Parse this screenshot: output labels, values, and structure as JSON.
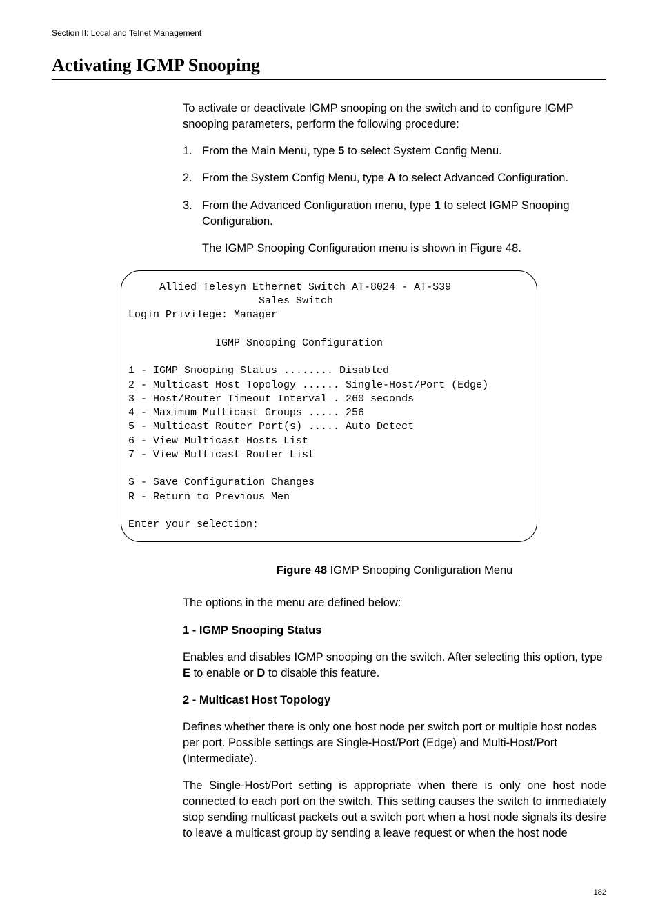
{
  "header": {
    "section": "Section II: Local and Telnet Management"
  },
  "title": "Activating IGMP Snooping",
  "intro": "To activate or deactivate IGMP snooping on the switch and to configure IGMP snooping parameters, perform the following procedure:",
  "steps": [
    {
      "num": "1.",
      "before": "From the Main Menu, type ",
      "key": "5",
      "after": " to select System Config Menu."
    },
    {
      "num": "2.",
      "before": "From the System Config Menu, type ",
      "key": "A",
      "after": " to select Advanced Configuration."
    },
    {
      "num": "3.",
      "before": "From the Advanced Configuration menu, type ",
      "key": "1",
      "after": " to select IGMP Snooping Configuration."
    }
  ],
  "after_steps": "The IGMP Snooping Configuration menu is shown in Figure 48.",
  "terminal": {
    "line_title": "     Allied Telesyn Ethernet Switch AT-8024 - AT-S39",
    "line_sub": "                     Sales Switch",
    "line_login": "Login Privilege: Manager",
    "line_menu": "              IGMP Snooping Configuration",
    "opt1": "1 - IGMP Snooping Status ........ Disabled",
    "opt2": "2 - Multicast Host Topology ...... Single-Host/Port (Edge)",
    "opt3": "3 - Host/Router Timeout Interval . 260 seconds",
    "opt4": "4 - Maximum Multicast Groups ..... 256",
    "opt5": "5 - Multicast Router Port(s) ..... Auto Detect",
    "opt6": "6 - View Multicast Hosts List",
    "opt7": "7 - View Multicast Router List",
    "optS": "S - Save Configuration Changes",
    "optR": "R - Return to Previous Men",
    "prompt": "Enter your selection:"
  },
  "figure": {
    "label": "Figure 48",
    "text": "  IGMP Snooping Configuration Menu"
  },
  "options_intro": "The options in the menu are defined below:",
  "option1": {
    "title": "1 - IGMP Snooping Status",
    "before": "Enables and disables IGMP snooping on the switch. After selecting this option, type ",
    "key1": "E",
    "mid": " to enable or ",
    "key2": "D",
    "after": " to disable this feature."
  },
  "option2": {
    "title": "2 - Multicast Host Topology",
    "para1": "Defines whether there is only one host node per switch port or multiple host nodes per port. Possible settings are Single-Host/Port (Edge) and Multi-Host/Port (Intermediate).",
    "para2": "The Single-Host/Port setting is appropriate when there is only one host node connected to each port on the switch. This setting causes the switch to immediately stop sending multicast packets out a switch port when a host node signals its desire to leave a multicast group by sending a leave request or when the host node"
  },
  "page_number": "182"
}
